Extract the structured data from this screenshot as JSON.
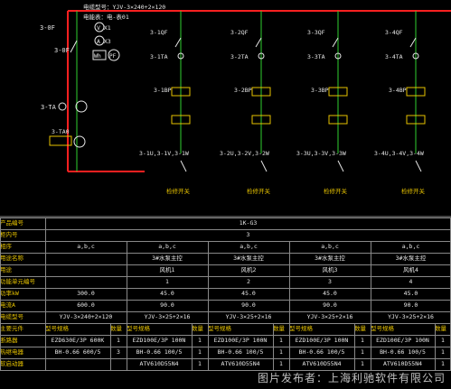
{
  "feeder": {
    "cable_spec": "电缆型号：YJV-3×240+2×120",
    "meter_label": "电能表：电-表01",
    "voltmeter": "V X1",
    "ammeter": "A X3",
    "switch_tags": [
      "3-0F",
      "3-0F"
    ],
    "ct_tags": [
      "3-TA",
      "3-TA0"
    ],
    "wh": "Wh",
    "pf": "PF"
  },
  "branches": [
    {
      "breaker": "3-1QF",
      "ct": "3-1TA",
      "relay": "3-1BP",
      "out": "3-1U,3-1V,3-1W",
      "note": "检修开关"
    },
    {
      "breaker": "3-2QF",
      "ct": "3-2TA",
      "relay": "3-2BP",
      "out": "3-2U,3-2V,3-2W",
      "note": "检修开关"
    },
    {
      "breaker": "3-3QF",
      "ct": "3-3TA",
      "relay": "3-3BP",
      "out": "3-3U,3-3V,3-3W",
      "note": "检修开关"
    },
    {
      "breaker": "3-4QF",
      "ct": "3-4TA",
      "relay": "3-4BP",
      "out": "3-4U,3-4V,3-4W",
      "note": "检修开关"
    }
  ],
  "table": {
    "labels": [
      "产品编号",
      "柜内号",
      "相序",
      "用途名称",
      "用途",
      "功能单元编号",
      "功率kW",
      "电流A",
      "电缆型号",
      "主要元件",
      "型号规格",
      "断路器",
      "热继电器",
      "软启动器"
    ],
    "cabinet_no": "1K-G3",
    "cabinet_seq": "3",
    "rows": [
      {
        "label": "相序",
        "values": [
          "a,b,c",
          "a,b,c",
          "a,b,c",
          "a,b,c",
          "a,b,c"
        ]
      },
      {
        "label": "用途名称",
        "values": [
          "",
          "3#水泵主控",
          "3#水泵主控",
          "3#水泵主控",
          "3#水泵主控"
        ]
      },
      {
        "label": "用途",
        "values": [
          "",
          "风机1",
          "风机2",
          "风机3",
          "风机4"
        ]
      },
      {
        "label": "功能单元编号",
        "values": [
          "",
          "1",
          "2",
          "3",
          "4"
        ]
      },
      {
        "label": "功率kW",
        "values": [
          "300.0",
          "45.0",
          "45.0",
          "45.0",
          "45.0"
        ]
      },
      {
        "label": "电流A",
        "values": [
          "600.0",
          "90.0",
          "90.0",
          "90.0",
          "90.0"
        ]
      },
      {
        "label": "电缆型号",
        "values": [
          "YJV-3×240+2×120",
          "YJV-3×25+2×16",
          "YJV-3×25+2×16",
          "YJV-3×25+2×16",
          "YJV-3×25+2×16"
        ]
      }
    ],
    "component_header": [
      "主要元件",
      "型号规格",
      "数量",
      "型号规格",
      "数量",
      "型号规格",
      "数量",
      "型号规格",
      "数量",
      "型号规格",
      "数量"
    ],
    "components": [
      {
        "label": "断路器",
        "cells": [
          "EZD630E/3P 600K",
          "1",
          "EZD100E/3P 100N",
          "1",
          "EZD100E/3P 100N",
          "1",
          "EZD100E/3P 100N",
          "1",
          "EZD100E/3P 100N",
          "1"
        ]
      },
      {
        "label": "热继电器",
        "cells": [
          "BH-0.66 600/5",
          "3",
          "BH-0.66 100/5",
          "1",
          "BH-0.66 100/5",
          "1",
          "BH-0.66 100/5",
          "1",
          "BH-0.66 100/5",
          "1"
        ]
      },
      {
        "label": "软启动器",
        "cells": [
          "",
          "",
          "ATV610D55N4",
          "1",
          "ATV610D55N4",
          "1",
          "ATV610D55N4",
          "1",
          "ATV610D55N4",
          "1"
        ]
      }
    ]
  },
  "watermark": "图片发布者：上海利驰软件有限公司",
  "colors": {
    "bus": "#ff2020",
    "green": "#30d030",
    "yellow": "#e6c200",
    "white": "#e6e6e6",
    "grid": "#888888"
  }
}
